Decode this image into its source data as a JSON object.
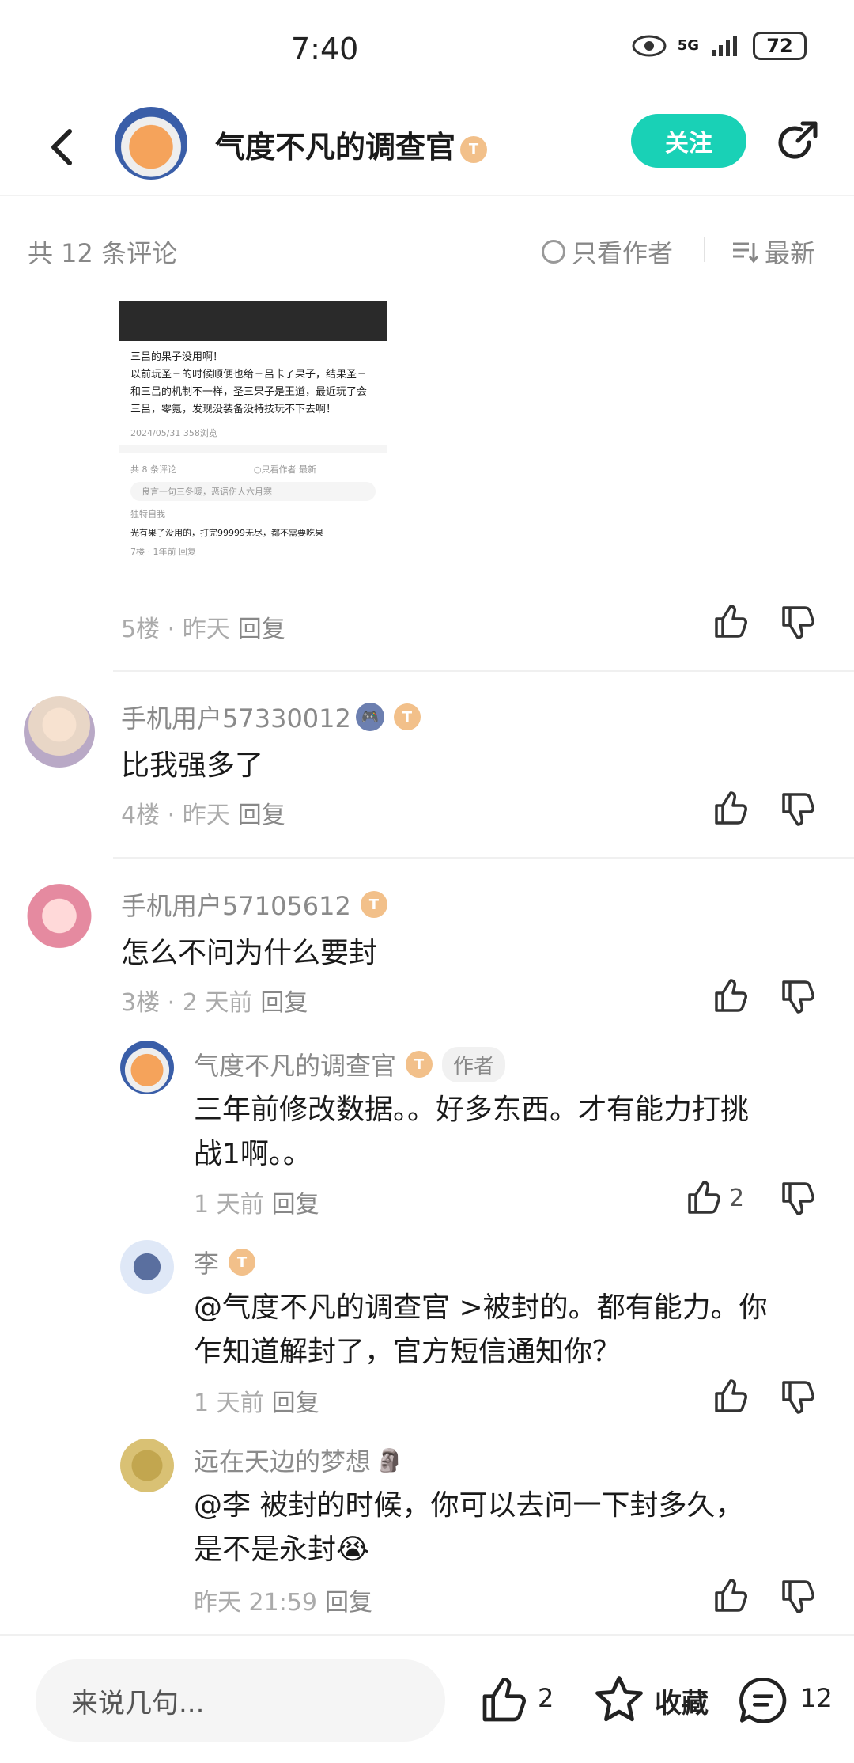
{
  "status": {
    "time": "7:40",
    "network": "5G",
    "battery": "72"
  },
  "header": {
    "name": "气度不凡的调查官",
    "level": "T",
    "follow_label": "关注"
  },
  "comment_bar": {
    "count": "共 12 条评论",
    "only_author": "只看作者",
    "sort": "最新"
  },
  "embedded_screenshot": {
    "title": "三吕的果子没用啊！",
    "body": "以前玩圣三的时候顺便也给三吕卡了果子，结果圣三和三吕的机制不一样，圣三果子是王道，最近玩了会三吕，零氪，发现没装备没特技玩不下去啊！",
    "date": "2024/05/31  358浏览",
    "comments_count": "共 8 条评论",
    "only_author": "只看作者",
    "newest": "最新",
    "input_placeholder": "良言一句三冬暖，恶语伤人六月寒",
    "commenter": "独特自我",
    "comment": "光有果子没用的，打完99999无尽，都不需要吃果",
    "comment_meta": "7楼 · 1年前  回复"
  },
  "comments": [
    {
      "meta": "5楼 · 昨天",
      "reply": "回复"
    },
    {
      "username": "手机用户57330012",
      "content": "比我强多了",
      "meta": "4楼 · 昨天",
      "reply": "回复"
    },
    {
      "username": "手机用户57105612",
      "content": "怎么不问为什么要封",
      "meta": "3楼 · 2 天前",
      "reply": "回复"
    }
  ],
  "replies": [
    {
      "username": "气度不凡的调查官",
      "tag": "作者",
      "content_line1": "三年前修改数据。。好多东西。才有能力打挑",
      "content_line2": "战1啊。。",
      "meta": "1 天前",
      "reply": "回复",
      "likes": "2"
    },
    {
      "username": "李",
      "content_line1": "@气度不凡的调查官  >被封的。都有能力。你",
      "content_line2": "乍知道解封了，官方短信通知你？",
      "meta": "1 天前",
      "reply": "回复"
    },
    {
      "username": "远在天边的梦想",
      "content_line1": "@李  被封的时候，你可以去问一下封多久，",
      "content_line2": "是不是永封😭",
      "meta": "昨天 21:59",
      "reply": "回复"
    }
  ],
  "bottom": {
    "input_placeholder": "来说几句...",
    "likes": "2",
    "favorite": "收藏",
    "comments": "12"
  },
  "colors": {
    "accent": "#19d1b6",
    "badge": "#f2c08a"
  }
}
